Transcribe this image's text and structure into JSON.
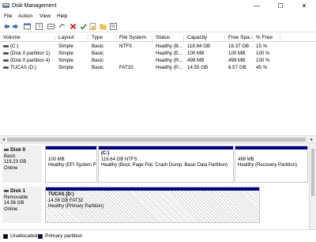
{
  "window": {
    "title": "Disk Management",
    "minimize": "—",
    "maximize": "☐",
    "close": "✕"
  },
  "menu": [
    "File",
    "Action",
    "View",
    "Help"
  ],
  "toolbar": {
    "icons": [
      "back-arrow-icon",
      "forward-arrow-icon",
      "properties-icon",
      "help-icon",
      "refresh-icon",
      "delete-icon",
      "checkmark-icon",
      "open-icon",
      "explore-icon",
      "properties-sheet-icon"
    ],
    "colors": {
      "delete": "#d11b1b",
      "check": "#2e7d32"
    }
  },
  "volume_list": {
    "columns": [
      "Volume",
      "Layout",
      "Type",
      "File System",
      "Status",
      "Capacity",
      "Free Spa...",
      "% Free"
    ],
    "rows": [
      [
        "(C:)",
        "Simple",
        "Basic",
        "NTFS",
        "Healthy (B...",
        "118.64 GB",
        "18.37 GB",
        "15 %"
      ],
      [
        "(Disk 0 partition 1)",
        "Simple",
        "Basic",
        "",
        "Healthy (E...",
        "100 MB",
        "100 MB",
        "100 %"
      ],
      [
        "(Disk 0 partition 4)",
        "Simple",
        "Basic",
        "",
        "Healthy (R...",
        "499 MB",
        "499 MB",
        "100 %"
      ],
      [
        "TUCAS (D:)",
        "Simple",
        "Basic",
        "FAT32",
        "Healthy (P...",
        "14.55 GB",
        "6.57 GB",
        "45 %"
      ]
    ]
  },
  "disks": [
    {
      "name": "Disk 0",
      "type": "Basic",
      "size": "119.23 GB",
      "status": "Online",
      "partitions": [
        {
          "title": "",
          "line1": "100 MB",
          "line2": "Healthy (EFI System P"
        },
        {
          "title": "(C:)",
          "line1": "118.64 GB NTFS",
          "line2": "Healthy (Boot, Page File, Crash Dump, Basic Data Partition)"
        },
        {
          "title": "",
          "line1": "499 MB",
          "line2": "Healthy (Recovery Partition)"
        }
      ]
    },
    {
      "name": "Disk 1",
      "type": "Removable",
      "size": "14.56 GB",
      "status": "Online",
      "partitions": [
        {
          "title": "TUCAS  (D:)",
          "line1": "14.56 GB FAT32",
          "line2": "Healthy (Primary Partition)"
        }
      ]
    }
  ],
  "legend": [
    {
      "label": "Unallocated",
      "color": "#000000"
    },
    {
      "label": "Primary partition",
      "color": "#00007a"
    }
  ]
}
